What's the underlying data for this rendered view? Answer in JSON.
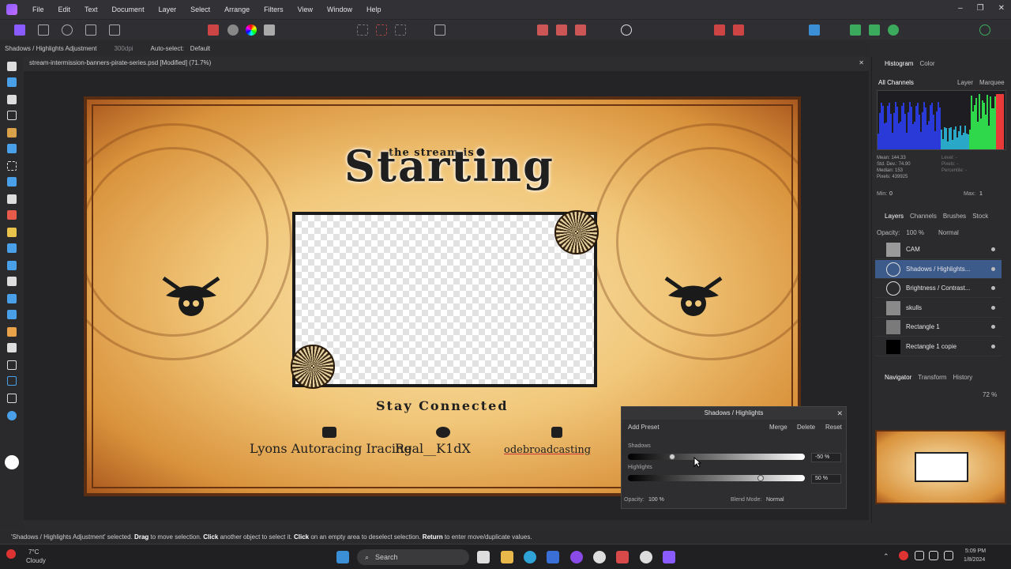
{
  "menubar": {
    "items": [
      "File",
      "Edit",
      "Text",
      "Document",
      "Layer",
      "Select",
      "Arrange",
      "Filters",
      "View",
      "Window",
      "Help"
    ],
    "window_controls": [
      "–",
      "❐",
      "✕"
    ]
  },
  "context_bar": {
    "mode": "Shadows / Highlights Adjustment",
    "dpi": "300dpi",
    "autoselect_label": "Auto-select:",
    "autoselect_value": "Default"
  },
  "document": {
    "tab_title": "stream-intermission-banners-pirate-series.psd [Modified] (71.7%)",
    "close": "✕"
  },
  "artwork": {
    "title_small": "the stream is",
    "title_big": "Starting",
    "stay_connected": "Stay Connected",
    "social_youtube": "Lyons Autoracing Iracing",
    "social_twitter": "Real__K1dX",
    "social_instagram": "odebroadcasting"
  },
  "histogram_panel": {
    "tabs": [
      "Histogram",
      "Color"
    ],
    "channel_select": "All Channels",
    "layer_label": "Layer",
    "marquee_label": "Marquee",
    "mean": "Mean: 144.33",
    "stddev": "Std. Dev.: 74.90",
    "median": "Median: 153",
    "pixels": "Pixels: 439925",
    "level": "Level: -",
    "pixels_r": "Pixels: -",
    "percentile": "Percentile: -",
    "min_label": "Min:",
    "min_value": "0",
    "max_label": "Max:",
    "max_value": "1"
  },
  "layers_panel": {
    "tabs": [
      "Layers",
      "Channels",
      "Brushes",
      "Stock"
    ],
    "opacity_label": "Opacity:",
    "opacity_value": "100 %",
    "blend_mode": "Normal",
    "layers": [
      {
        "name": "CAM"
      },
      {
        "name": "Shadows / Highlights..."
      },
      {
        "name": "Brightness / Contrast..."
      },
      {
        "name": "skulls"
      },
      {
        "name": "Rectangle 1"
      },
      {
        "name": "Rectangle 1 copie"
      }
    ]
  },
  "navigator_panel": {
    "tabs": [
      "Navigator",
      "Transform",
      "History"
    ],
    "zoom_value": "72 %"
  },
  "sh_dialog": {
    "title": "Shadows / Highlights",
    "add_preset": "Add Preset",
    "merge": "Merge",
    "delete": "Delete",
    "reset": "Reset",
    "shadows_label": "Shadows",
    "shadows_value": "-50 %",
    "shadows_level": -0.5,
    "highlights_label": "Highlights",
    "highlights_value": "50 %",
    "highlights_level": 0.5,
    "opacity_label": "Opacity:",
    "opacity_value": "100 %",
    "blend_label": "Blend Mode:",
    "blend_value": "Normal"
  },
  "statusbar": {
    "selected_text": "'Shadows / Highlights Adjustment' selected.",
    "drag": "Drag",
    "drag_text": "to move selection.",
    "click": "Click",
    "click_text": "another object to select it.",
    "click2": "Click",
    "click2_text": "on an empty area to deselect selection.",
    "return": "Return",
    "return_text": "to enter move/duplicate values."
  },
  "taskbar": {
    "weather_temp": "7°C",
    "weather_desc": "Cloudy",
    "search_placeholder": "Search",
    "time": "5:09 PM",
    "date": "1/8/2024"
  }
}
